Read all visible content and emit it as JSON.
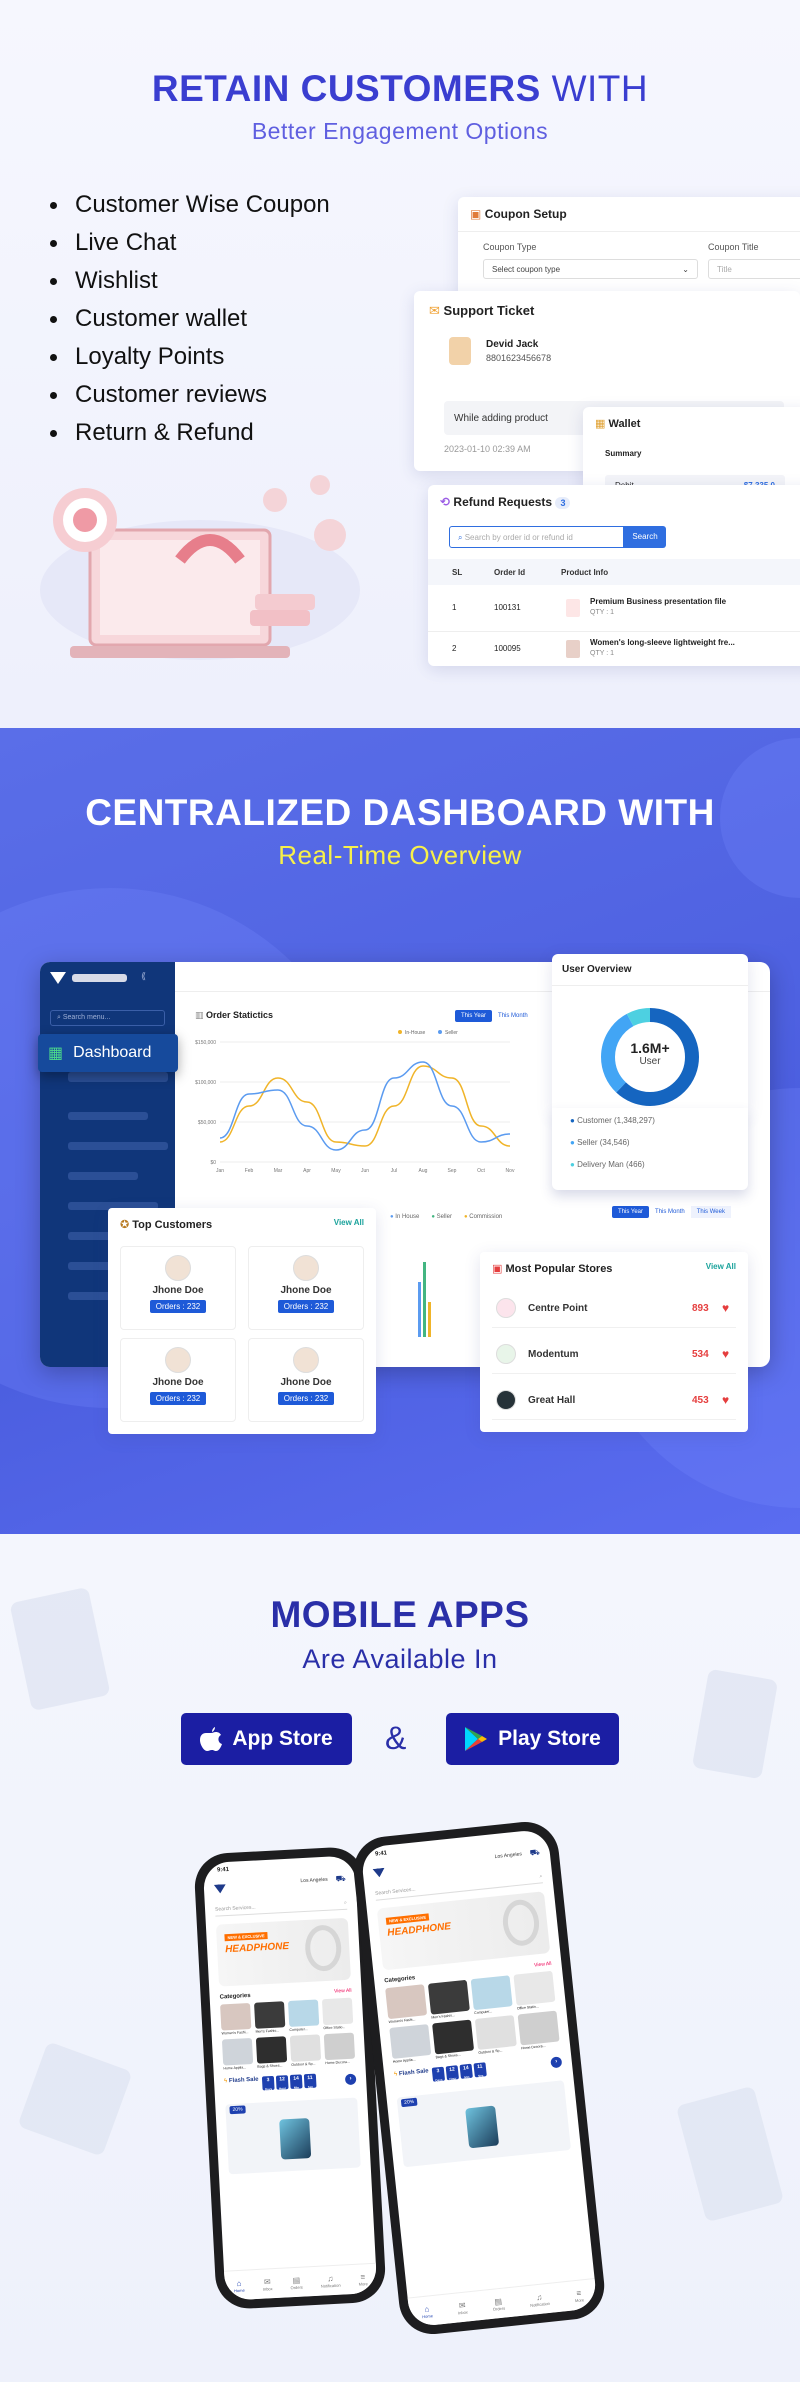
{
  "hero": {
    "title_bold": "RETAIN CUSTOMERS",
    "title_light": "WITH",
    "subtitle": "Better Engagement Options",
    "features": [
      "Customer Wise Coupon",
      "Live Chat",
      "Wishlist",
      "Customer wallet",
      "Loyalty Points",
      "Customer reviews",
      "Return & Refund"
    ]
  },
  "coupon": {
    "title": "Coupon Setup",
    "type_label": "Coupon Type",
    "title_label": "Coupon Title",
    "type_placeholder": "Select coupon type",
    "title_placeholder": "Title"
  },
  "ticket": {
    "title": "Support Ticket",
    "name": "Devid Jack",
    "phone": "8801623456678",
    "message": "While adding product",
    "timestamp": "2023-01-10 02:39 AM"
  },
  "wallet": {
    "title": "Wallet",
    "summary": "Summary",
    "debit_label": "Debit",
    "debit_value": "$7,335.0"
  },
  "refund": {
    "title": "Refund Requests",
    "count": "3",
    "search_placeholder": "Search by order id or refund id",
    "search_button": "Search",
    "columns": [
      "SL",
      "Order Id",
      "Product Info"
    ],
    "rows": [
      {
        "sl": "1",
        "order": "100131",
        "product": "Premium Business presentation file",
        "qty": "QTY : 1"
      },
      {
        "sl": "2",
        "order": "100095",
        "product": "Women's long-sleeve lightweight fre...",
        "qty": "QTY : 1"
      }
    ]
  },
  "dashboard_section": {
    "title": "CENTRALIZED DASHBOARD WITH",
    "subtitle": "Real-Time Overview",
    "search_placeholder": "Search menu...",
    "sidebar_active": "Dashboard",
    "chart_title": "Order Statictics",
    "period_tabs": [
      "This Year",
      "This Month"
    ],
    "period_tabs_2": [
      "This Year",
      "This Month",
      "This Week"
    ],
    "legend_2": [
      "In House",
      "Seller",
      "Commission"
    ]
  },
  "chart_data": {
    "type": "line",
    "title": "Order Statictics",
    "categories": [
      "Jan",
      "Feb",
      "Mar",
      "Apr",
      "May",
      "Jun",
      "Jul",
      "Aug",
      "Sep",
      "Oct",
      "Nov"
    ],
    "yticks": [
      "$0",
      "$50,000",
      "$100,000",
      "$150,000"
    ],
    "ylim": [
      0,
      150000
    ],
    "series": [
      {
        "name": "In-House",
        "color": "#f0b429",
        "values": [
          25000,
          70000,
          105000,
          75000,
          25000,
          20000,
          70000,
          120000,
          105000,
          45000,
          20000
        ]
      },
      {
        "name": "Seller",
        "color": "#5b9bf0",
        "values": [
          30000,
          85000,
          90000,
          45000,
          15000,
          40000,
          105000,
          125000,
          70000,
          25000,
          35000
        ]
      }
    ],
    "legend_position": "top-right",
    "grid": true
  },
  "user_overview": {
    "title": "User Overview",
    "total": "1.6M+",
    "total_label": "User",
    "legend": [
      {
        "label": "Customer (1,348,297)",
        "color": "#1565c0"
      },
      {
        "label": "Seller (34,546)",
        "color": "#42a5f5"
      },
      {
        "label": "Delivery Man (466)",
        "color": "#4dd0e1"
      }
    ],
    "donut": [
      {
        "value": 1348297,
        "color": "#1565c0"
      },
      {
        "value": 34546,
        "color": "#42a5f5"
      },
      {
        "value": 466,
        "color": "#4dd0e1"
      }
    ]
  },
  "top_customers": {
    "title": "Top Customers",
    "view_all": "View All",
    "items": [
      {
        "name": "Jhone Doe",
        "orders": "Orders : 232"
      },
      {
        "name": "Jhone Doe",
        "orders": "Orders : 232"
      },
      {
        "name": "Jhone Doe",
        "orders": "Orders : 232"
      },
      {
        "name": "Jhone Doe",
        "orders": "Orders : 232"
      }
    ]
  },
  "popular_stores": {
    "title": "Most Popular Stores",
    "view_all": "View All",
    "items": [
      {
        "name": "Centre Point",
        "count": "893"
      },
      {
        "name": "Modentum",
        "count": "534"
      },
      {
        "name": "Great Hall",
        "count": "453"
      }
    ]
  },
  "mobile": {
    "title": "MOBILE APPS",
    "subtitle": "Are Available In",
    "app_store": "App Store",
    "ampersand": "&",
    "play_store": "Play Store"
  },
  "phone_app": {
    "time": "9:41",
    "location": "Los Angeles",
    "search_placeholder": "Search Services...",
    "banner_tag": "NEW & EXCLUSIVE",
    "banner_title": "HEADPHONE",
    "categories_title": "Categories",
    "view_all": "View All",
    "categories": [
      "Women's Fashi...",
      "Men's Fashio...",
      "Computer...",
      "Office Statio...",
      "Home Applia...",
      "Bags & Shoes...",
      "Outdoor & Sp...",
      "Home Decora..."
    ],
    "flash_sale": "Flash Sale",
    "countdown": [
      "3",
      "12",
      "14",
      "11"
    ],
    "countdown_units": [
      "Days",
      "Hour",
      "Min",
      "Sec"
    ],
    "discount": "20%",
    "nav": [
      "Home",
      "Inbox",
      "Orders",
      "Notification",
      "More"
    ]
  }
}
